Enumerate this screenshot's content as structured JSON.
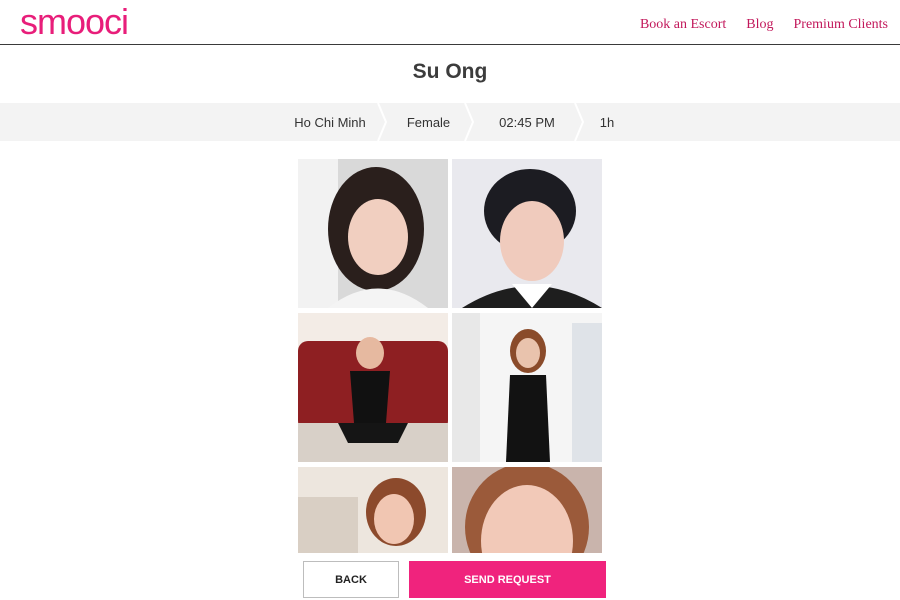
{
  "header": {
    "logo": "smooci",
    "nav": [
      "Book an Escort",
      "Blog",
      "Premium Clients"
    ]
  },
  "profile": {
    "name": "Su Ong"
  },
  "booking_steps": [
    "Ho Chi Minh",
    "Female",
    "02:45 PM",
    "1h"
  ],
  "actions": {
    "back": "BACK",
    "send": "SEND REQUEST"
  },
  "colors": {
    "brand": "#e81e7a",
    "nav_link": "#c2185b",
    "send_button": "#f0237d",
    "strip_bg": "#f3f3f3"
  }
}
